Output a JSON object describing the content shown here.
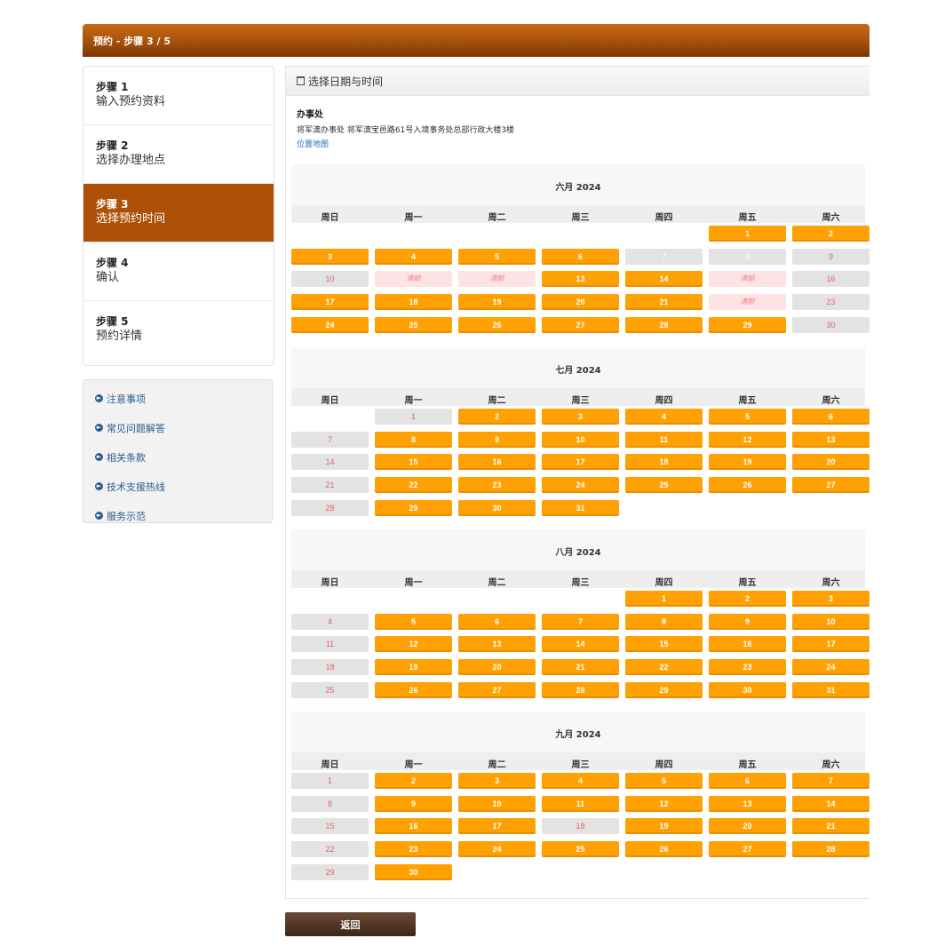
{
  "header": {
    "title": "预约 - 步骤 3 / 5"
  },
  "steps": [
    {
      "title": "步骤 1",
      "label": "输入预约资料",
      "active": false
    },
    {
      "title": "步骤 2",
      "label": "选择办理地点",
      "active": false
    },
    {
      "title": "步骤 3",
      "label": "选择预约时间",
      "active": true
    },
    {
      "title": "步骤 4",
      "label": "确认",
      "active": false
    },
    {
      "title": "步骤 5",
      "label": "预约详情",
      "active": false
    }
  ],
  "links": [
    "注意事项",
    "常见问题解答",
    "相关条款",
    "技术支援热线",
    "服务示范"
  ],
  "panel": {
    "title": "选择日期与时间",
    "office_heading": "办事处",
    "office_address": "将军澳办事处 将军澳宝邑路61号入境事务处总部行政大楼3楼",
    "map_link": "位置地图"
  },
  "weekdays": [
    "周日",
    "周一",
    "周二",
    "周三",
    "周四",
    "周五",
    "周六"
  ],
  "full_label": "满额",
  "months": [
    {
      "title": "六月 2024",
      "start": 5,
      "days": 30,
      "status": {
        "7": "off",
        "8": "off",
        "9": "sun",
        "10": "grey",
        "11": "full",
        "12": "full",
        "15": "full",
        "16": "sun",
        "22": "full",
        "23": "sun",
        "30": "sun"
      }
    },
    {
      "title": "七月 2024",
      "start": 1,
      "days": 31,
      "status": {
        "1": "grey",
        "7": "sun",
        "14": "sun",
        "21": "sun",
        "28": "sun"
      }
    },
    {
      "title": "八月 2024",
      "start": 4,
      "days": 31,
      "status": {
        "4": "sun",
        "11": "sun",
        "18": "sun",
        "25": "sun"
      }
    },
    {
      "title": "九月 2024",
      "start": 0,
      "days": 30,
      "status": {
        "1": "sun",
        "8": "sun",
        "15": "sun",
        "18": "grey",
        "22": "sun",
        "29": "sun"
      }
    }
  ],
  "buttons": {
    "back": "返回"
  },
  "colors": {
    "accent": "#ac4f07",
    "available": "#ffa102",
    "full": "#fde3e3"
  }
}
